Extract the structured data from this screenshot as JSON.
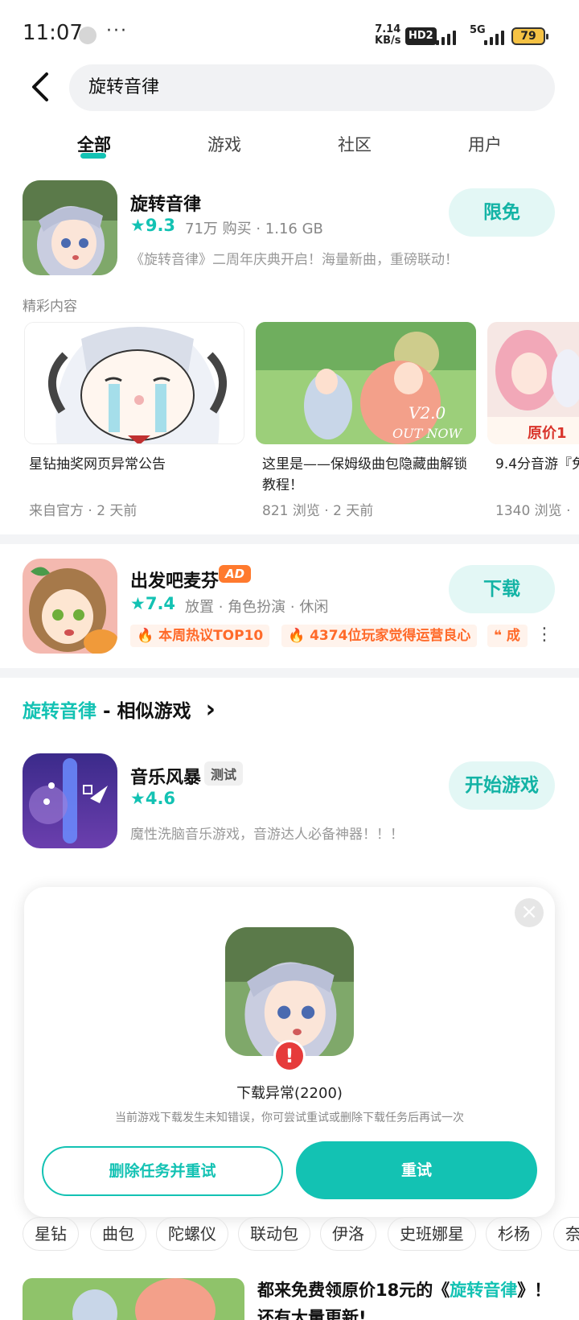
{
  "status_bar": {
    "time": "11:07",
    "dots": "···",
    "speed_top": "7.14",
    "speed_unit": "KB/s",
    "hd_label": "HD2",
    "network": "5G",
    "battery": "79"
  },
  "search": {
    "query": "旋转音律"
  },
  "tabs": [
    {
      "label": "全部",
      "active": true
    },
    {
      "label": "游戏",
      "active": false
    },
    {
      "label": "社区",
      "active": false
    },
    {
      "label": "用户",
      "active": false
    }
  ],
  "main_app": {
    "name": "旋转音律",
    "rating": "★9.3",
    "meta": "71万 购买 · 1.16 GB",
    "description": "《旋转音律》二周年庆典开启！海量新曲，重磅联动！",
    "button": "限免"
  },
  "highlights": {
    "label": "精彩内容",
    "items": [
      {
        "title": "星钻抽奖网页异常公告",
        "meta": "来自官方 · 2 天前"
      },
      {
        "title": "这里是——保姆级曲包隐藏曲解锁教程！",
        "meta": "821 浏览 · 2 天前"
      },
      {
        "title": "9.4分音游『免",
        "meta": "1340 浏览 ·",
        "badge": "原价1"
      }
    ],
    "thumb2_text": "V2.0 OUT NOW"
  },
  "ad_app": {
    "name": "出发吧麦芬",
    "ad_label": "AD",
    "rating": "★7.4",
    "meta": "放置 · 角色扮演 · 休闲",
    "button": "下载",
    "tags": [
      "🔥 本周热议TOP10",
      "🔥 4374位玩家觉得运营良心",
      "❝ 成"
    ],
    "more": "⋮"
  },
  "similar": {
    "highlight": "旋转音律",
    "title_rest": " - 相似游戏",
    "chevron": "›",
    "app": {
      "name": "音乐风暴",
      "badge": "测试",
      "rating": "★4.6",
      "description": "魔性洗脑音乐游戏，音游达人必备神器！！！",
      "button": "开始游戏"
    }
  },
  "dialog": {
    "close": "×",
    "error_mark": "!",
    "title": "下载异常(2200)",
    "subtitle": "当前游戏下载发生未知错误，你可尝试重试或删除下载任务后再试一次",
    "secondary_button": "删除任务并重试",
    "primary_button": "重试"
  },
  "chips": [
    "星钻",
    "曲包",
    "陀螺仪",
    "联动包",
    "伊洛",
    "史班娜星",
    "杉杨",
    "奈"
  ],
  "bottom_post": {
    "prefix": "都来免费领原价18元的《",
    "highlight": "旋转音律",
    "suffix": "》！",
    "line2": "还有大量更新!"
  },
  "colors": {
    "accent": "#13c2b3",
    "pill_bg": "#e3f7f5",
    "hot_tag": "#ff6a2a",
    "error": "#e63b3b"
  }
}
